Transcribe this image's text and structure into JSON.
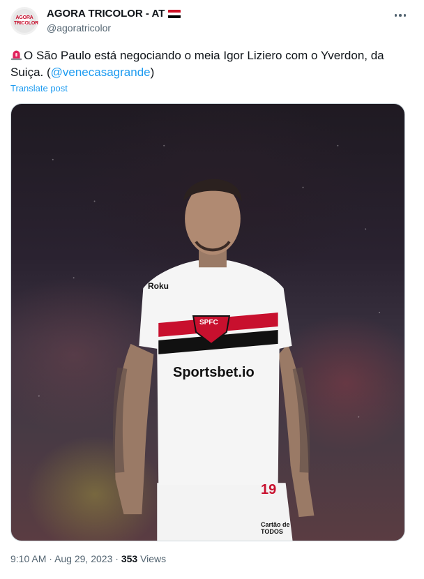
{
  "author": {
    "display_name": "AGORA TRICOLOR - AT",
    "handle": "@agoratricolor",
    "avatar_text": "AGORA TRICOLOR",
    "flag_icon": "egypt-flag-icon",
    "flag_colors": [
      "#ce1126",
      "#ffffff",
      "#000000"
    ]
  },
  "tweet": {
    "emoji_icon": "police-siren-icon",
    "text_main": "O São Paulo está negociando o meia Igor Liziero com o Yverdon, da Suiça. (",
    "mention": "@venecasagrande",
    "text_end": ")",
    "translate_label": "Translate post"
  },
  "media": {
    "alt": "Photo of a São Paulo FC player in a white jersey",
    "jersey_texts": {
      "sponsor_main": "Sportsbet.io",
      "sponsor_sleeve": "Roku",
      "crest": "SPFC",
      "shorts_sponsor": "Cartão de TODOS",
      "number": "19"
    }
  },
  "footer": {
    "time": "9:10 AM",
    "separator": "·",
    "date": "Aug 29, 2023",
    "views_count": "353",
    "views_label": "Views"
  },
  "colors": {
    "link": "#1d9bf0",
    "secondary_text": "#536471",
    "primary_text": "#0f1419"
  }
}
